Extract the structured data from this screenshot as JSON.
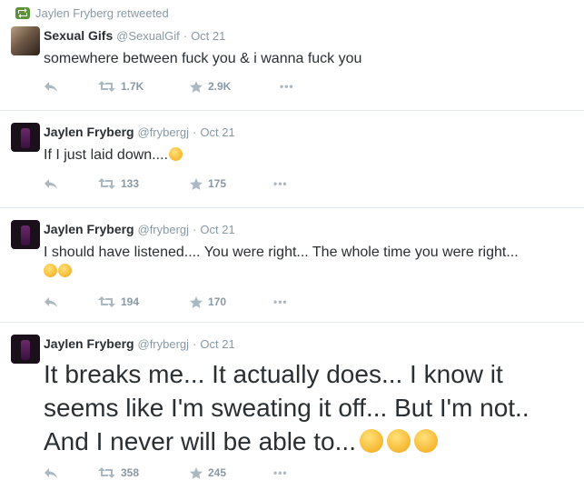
{
  "tweets": [
    {
      "retweet_label": "Jaylen Fryberg retweeted",
      "name": "Sexual Gifs",
      "handle": "@SexualGif",
      "time": "Oct 21",
      "text": "somewhere between fuck you & i wanna fuck you",
      "retweets": "1.7K",
      "favorites": "2.9K"
    },
    {
      "name": "Jaylen Fryberg",
      "handle": "@frybergj",
      "time": "Oct 21",
      "text": "If I just laid down....",
      "retweets": "133",
      "favorites": "175"
    },
    {
      "name": "Jaylen Fryberg",
      "handle": "@frybergj",
      "time": "Oct 21",
      "text": "I should have listened.... You were right... The whole time you were right...",
      "retweets": "194",
      "favorites": "170"
    },
    {
      "name": "Jaylen Fryberg",
      "handle": "@frybergj",
      "time": "Oct 21",
      "text": "It breaks me... It actually does... I know it seems like I'm sweating it off... But I'm not.. And I never will be able to...",
      "retweets": "358",
      "favorites": "245"
    }
  ],
  "icons": {
    "reply": "reply-icon",
    "retweet": "retweet-icon",
    "favorite": "star-icon",
    "more": "more-icon"
  },
  "colors": {
    "retweet_green": "#5c913b",
    "meta_gray": "#8899a6",
    "text": "#292f33"
  }
}
